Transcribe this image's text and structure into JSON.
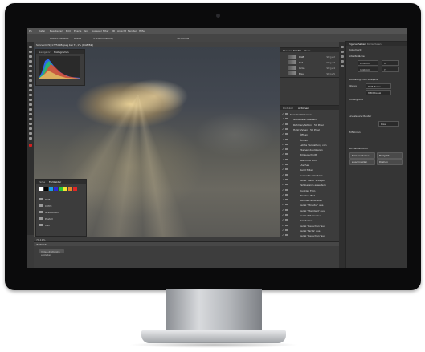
{
  "app": {
    "menu": [
      "PS",
      "Datei",
      "Bearbeiten",
      "Bild",
      "Ebene",
      "Text",
      "Auswahl",
      "Filter",
      "3D",
      "Ansicht",
      "Fenster",
      "Hilfe"
    ],
    "options": [
      "Kollekt. deaktiv.",
      "Breite",
      "Transformierung",
      "3D-Modus"
    ],
    "document_tab": "Sonnenlicht_1775998.jpeg bei 71,1% (RGB/8#)"
  },
  "canvas": {
    "status": "71,11%",
    "content": "clouds-with-sunrays"
  },
  "histogram_panel": {
    "tabs": [
      "Navigator",
      "Histogramm"
    ],
    "active": "Histogramm",
    "colors": [
      "#2f6cff",
      "#28c75a",
      "#ff3b2f"
    ]
  },
  "swatches_panel": {
    "tabs": [
      "Farbe",
      "Farbfelder"
    ],
    "colors": [
      "#ffffff",
      "#000000",
      "#1a9be6",
      "#2b2bd9",
      "#29c43c",
      "#f5e633",
      "#e6852b",
      "#e02626"
    ],
    "folders": [
      "RGB",
      "CMYK",
      "Graustufen",
      "Pastell",
      "Hell"
    ]
  },
  "channels_panel": {
    "tabs": [
      "Ebenen",
      "Kanäle",
      "Pfade"
    ],
    "active": "Kanäle",
    "rows": [
      {
        "name": "RGB",
        "shortcut": "Strg+2"
      },
      {
        "name": "Rot",
        "shortcut": "Strg+3"
      },
      {
        "name": "Grün",
        "shortcut": "Strg+4"
      },
      {
        "name": "Blau",
        "shortcut": "Strg+5"
      }
    ]
  },
  "history_panel": {
    "tabs": [
      "Protokoll",
      "Aktionen"
    ],
    "active": "Aktionen",
    "rows": [
      "Standardaktionen",
      "Gestaltete Auswahl",
      "Rahmen/Aktion - 50 Pixel",
      "Holzrahmen - 50 Pixel",
      "Öffnen",
      "Öffnen",
      "Letzte Verwaltung von",
      "Ebenen duplizieren",
      "Bildausschnitt",
      "Beschnitt Bild",
      "Löschen",
      "Rand füllen",
      "Auswahl umkehren",
      "Kanal 'Geist' anlegen",
      "Farbbereich erweitern",
      "Dunkles Foto",
      "Weiches Bild",
      "Rahmen einstellen",
      "Kanal 'Struktur' aus",
      "Kanal 'Standard' aus",
      "Kanal 'Fläche' aus",
      "Freistellen",
      "Kanal 'Rauschen' aus",
      "Kanal 'Farbe' aus",
      "Kanal 'Rauschen' aus"
    ]
  },
  "properties_panel": {
    "tabs": [
      "Eigenschaften",
      "Korrekturen"
    ],
    "sections": {
      "document": "Dokument",
      "canvas": "Arbeitsfläche",
      "resolution": "Auflösung: 300 Pixel/Zoll",
      "mode": "Modus",
      "mode_value": "RGB-Farbe",
      "depth_value": "8 Bit/Kanal",
      "fill": "Hintergrund",
      "rulers": "Lineale und Raster",
      "guides": "Hilfslinien",
      "quick_actions": "Schnellaktionen"
    },
    "fields": {
      "width": "2,56 cm",
      "height": "1,44 cm",
      "x": "X",
      "y": "Y",
      "unit": "Pixel"
    },
    "buttons": [
      "Bild freistellen",
      "Bildgröße",
      "Zuschneiden",
      "Drehen"
    ]
  },
  "timeline": {
    "title": "Zeitleiste",
    "button": "Video-Zeitleiste erstellen"
  }
}
